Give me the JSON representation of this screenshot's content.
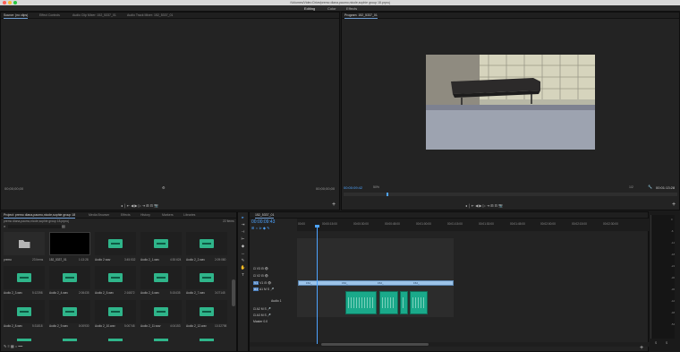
{
  "window": {
    "title": "/Volumes/Video Drive/premo diana,paumo,nicole,sophie group 18.prproj"
  },
  "workspaces": [
    "Editing",
    "Color",
    "Effects"
  ],
  "source_panel": {
    "tabs": [
      "Source: (no clips)",
      "Effect Controls",
      "Audio Clip Mixer: 152_5337_01",
      "Audio Track Mixer: 152_5337_01"
    ],
    "timecode_left": "00;00;00;00",
    "timecode_right": "00;00;00;00",
    "add_label": "+"
  },
  "program_panel": {
    "tab": "Program: 152_5337_01",
    "timecode": "00:00:09:42",
    "zoom": "50%",
    "resolution": "1/2",
    "duration": "00:01:13:28",
    "add_label": "+"
  },
  "project_panel": {
    "tabs": [
      "Project: premo diana,paumo,nicole,sophie group 18",
      "Media Browser",
      "Effects",
      "History",
      "Markers",
      "Libraries"
    ],
    "path": "premo diana,paumo,nicole,sophie group 18.prproj",
    "item_count": "22 Items",
    "items": [
      {
        "name": "premo",
        "dur": "23 Items",
        "type": "folder"
      },
      {
        "name": "152_5337_01",
        "dur": "1:13:28",
        "type": "video"
      },
      {
        "name": "Audio 2.wav",
        "dur": "3:45:532",
        "type": "audio"
      },
      {
        "name": "Audio 2_1.wav",
        "dur": "4:30:624",
        "type": "audio"
      },
      {
        "name": "Audio 2_2.wav",
        "dur": "2:09:080",
        "type": "audio"
      },
      {
        "name": "Audio 2_3.wav",
        "dur": "5:12398",
        "type": "audio"
      },
      {
        "name": "Audio 2_4.wav",
        "dur": "2:06435",
        "type": "audio"
      },
      {
        "name": "Audio 2_5.wav",
        "dur": "2:16872",
        "type": "audio"
      },
      {
        "name": "Audio 2_6.wav",
        "dur": "5:15435",
        "type": "audio"
      },
      {
        "name": "Audio 2_7.wav",
        "dur": "3:07145",
        "type": "audio"
      },
      {
        "name": "Audio 2_8.wav",
        "dur": "5:31818",
        "type": "audio"
      },
      {
        "name": "Audio 2_9.wav",
        "dur": "8:00930",
        "type": "audio"
      },
      {
        "name": "Audio 2_10.wav",
        "dur": "5:00748",
        "type": "audio"
      },
      {
        "name": "Audio 2_11.wav",
        "dur": "4:04153",
        "type": "audio"
      },
      {
        "name": "Audio 2_12.wav",
        "dur": "10:32798",
        "type": "audio"
      }
    ]
  },
  "timeline": {
    "tab": "152_5337_01",
    "timecode": "00:00:09:43",
    "ruler": [
      "00:00",
      "00:00:15:00",
      "00:00:30:00",
      "00:00:45:00",
      "00:01:00:00",
      "00:01:15:00",
      "00:01:30:00",
      "00:01:45:00",
      "00:02:00:00",
      "00:02:15:00",
      "00:02:30:00",
      "00:02:45:00",
      "00:03:00:00",
      "00:03:15:00"
    ],
    "tracks": {
      "video": [
        "V3",
        "V2",
        "V1"
      ],
      "audio": [
        "A1",
        "A2",
        "A3"
      ],
      "audio_name": "Audio 1",
      "master_label": "Master",
      "master_val": "0.0"
    },
    "clip_label": "152_"
  },
  "meters": {
    "scale": [
      "0",
      "-6",
      "-12",
      "-18",
      "-24",
      "-30",
      "-36",
      "-42",
      "-48",
      "-54"
    ],
    "bottom": [
      "S",
      "S"
    ]
  },
  "colors": {
    "accent": "#4da3ff",
    "audio_clip": "#1aa98a",
    "video_clip": "#9cc3e8"
  }
}
